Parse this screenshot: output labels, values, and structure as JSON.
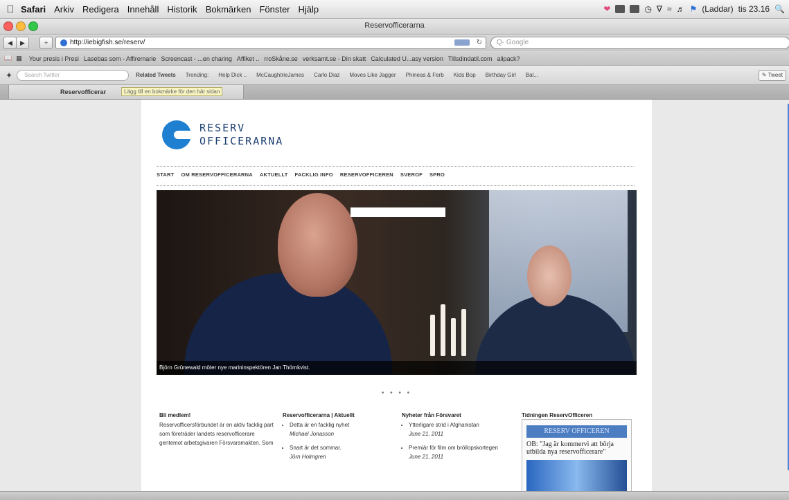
{
  "menubar": {
    "app": "Safari",
    "items": [
      "Arkiv",
      "Redigera",
      "Innehåll",
      "Historik",
      "Bokmärken",
      "Fönster",
      "Hjälp"
    ],
    "user": "(Laddar)",
    "clock": "tis 23.16"
  },
  "window": {
    "title": "Reservofficerarna"
  },
  "toolbar": {
    "url": "http://iebigfish.se/reserv/",
    "search_placeholder": "Q- Google"
  },
  "bookmarks": [
    "Your presis i Presi",
    "Lasebas som - Affiremarie",
    "Screencast - ...en charing",
    "Affiket ..",
    "rroSkåne.se",
    "verksamt.se - Din skatt",
    "Calculated U...asy version",
    "Tillsdindatil.com",
    "alipack?"
  ],
  "twitter": {
    "search_placeholder": "Search Twitter",
    "items": [
      "Related Tweets",
      "Trending:",
      "Help Dick ..",
      "McCaughtrieJames",
      "Carlo Diaz",
      "Moves Like Jagger",
      "Phineas & Ferb",
      "Kids Bop",
      "Birthday Girl",
      "Bal..."
    ],
    "tweet_label": "Tweet"
  },
  "tab": {
    "label": "Reservofficerar",
    "tooltip": "Lägg till en bokmärke för den här sidan"
  },
  "site": {
    "logo_line1": "RESERV",
    "logo_line2": "OFFICERARNA",
    "nav": [
      "START",
      "OM RESERVOFFICERARNA",
      "AKTUELLT",
      "FACKLIG INFO",
      "RESERVOFFICEREN",
      "SVEROF",
      "SPRO"
    ],
    "hero_caption": "Björn Grünewald möter nye marininspektören Jan Thörnkvist.",
    "slider_dots": "• • • •",
    "columns": [
      {
        "heading": "Bli medlem!",
        "text": "Reservofficersförbundet är en aktiv facklig part som företräder landets reservofficerare gentemot arbetsgivaren Försvarsmakten. Som"
      },
      {
        "heading": "Reservofficerarna | Aktuellt",
        "items": [
          {
            "title": "Detta är en facklig nyhet",
            "by": "Michael Jonasson"
          },
          {
            "title": "Snart är det sommar.",
            "by": "Jörn Holmgren"
          }
        ]
      },
      {
        "heading": "Nyheter från Försvaret",
        "items": [
          {
            "title": "Ytterligare strid i Afghanistan",
            "by": "June 21, 2011"
          },
          {
            "title": "Premiär för film om bröllopskortegen",
            "by": "June 21, 2011"
          }
        ]
      }
    ],
    "tidning": {
      "heading": "Tidningen ReservOfficeren",
      "masthead": "RESERV OFFICEREN",
      "headline": "OB: \"Jag är kommervi att börja utbilda nya reservofficerare\""
    }
  },
  "colors": {
    "brand_blue": "#1f7fd0",
    "logo_text": "#1c3f72"
  }
}
